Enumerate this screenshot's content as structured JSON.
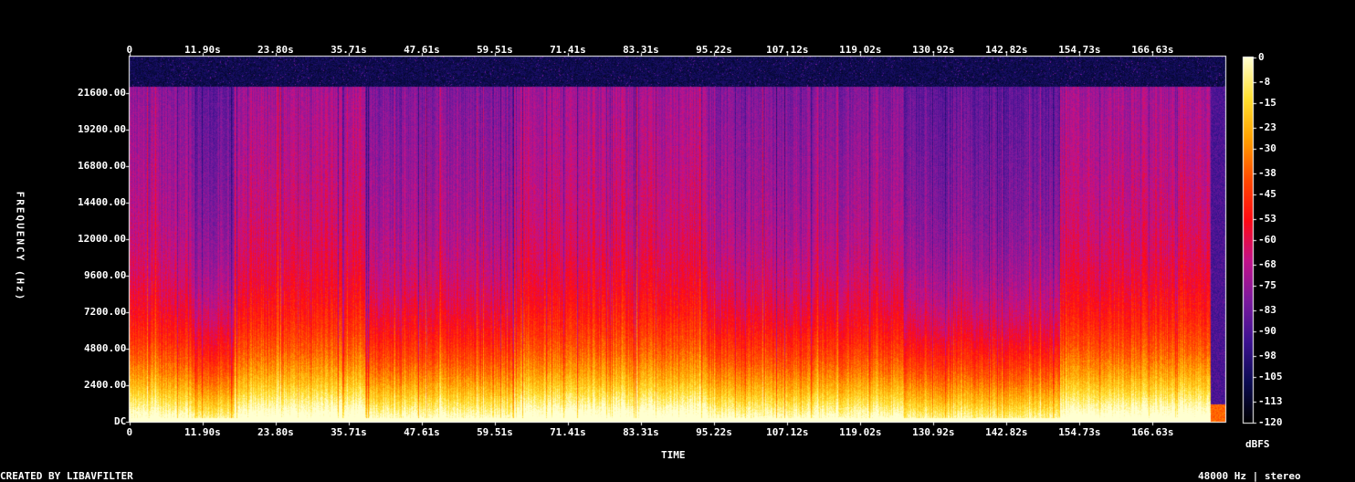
{
  "chart_data": {
    "type": "heatmap",
    "title": "",
    "xlabel": "TIME",
    "ylabel": "FREQUENCY (Hz)",
    "x_ticks": [
      "0",
      "11.90s",
      "23.80s",
      "35.71s",
      "47.61s",
      "59.51s",
      "71.41s",
      "83.31s",
      "95.22s",
      "107.12s",
      "119.02s",
      "130.92s",
      "142.82s",
      "154.73s",
      "166.63s"
    ],
    "x_tick_values": [
      0,
      11.9,
      23.8,
      35.71,
      47.61,
      59.51,
      71.41,
      83.31,
      95.22,
      107.12,
      119.02,
      130.92,
      142.82,
      154.73,
      166.63
    ],
    "xlim": [
      0,
      178.5
    ],
    "y_ticks": [
      "DC",
      "2400.00",
      "4800.00",
      "7200.00",
      "9600.00",
      "12000.00",
      "14400.00",
      "16800.00",
      "19200.00",
      "21600.00"
    ],
    "y_tick_values": [
      0,
      2400,
      4800,
      7200,
      9600,
      12000,
      14400,
      16800,
      19200,
      21600
    ],
    "ylim": [
      0,
      24000
    ],
    "content_cutoff_hz": 22050,
    "colorbar": {
      "label": "dBFS",
      "ticks": [
        "0",
        "-8",
        "-15",
        "-23",
        "-30",
        "-38",
        "-45",
        "-53",
        "-60",
        "-68",
        "-75",
        "-83",
        "-90",
        "-98",
        "-105",
        "-113",
        "-120"
      ],
      "range": [
        -120,
        0
      ],
      "colormap": [
        "#000000",
        "#0c0c52",
        "#3c1290",
        "#7a1a9e",
        "#c2128a",
        "#ff0a14",
        "#ff4a00",
        "#ffa000",
        "#ffe030",
        "#ffffd0"
      ]
    },
    "sections_seconds": [
      {
        "start": 0,
        "end": 10,
        "level": "busy-bands"
      },
      {
        "start": 10,
        "end": 17,
        "level": "quiet"
      },
      {
        "start": 17,
        "end": 38.5,
        "level": "loud"
      },
      {
        "start": 38.5,
        "end": 62.5,
        "level": "medium"
      },
      {
        "start": 62.5,
        "end": 94,
        "level": "loud"
      },
      {
        "start": 94,
        "end": 126,
        "level": "medium"
      },
      {
        "start": 126,
        "end": 151.5,
        "level": "quiet"
      },
      {
        "start": 151.5,
        "end": 176,
        "level": "loud"
      },
      {
        "start": 176,
        "end": 178.5,
        "level": "fade"
      }
    ]
  },
  "footer": {
    "left": "CREATED BY LIBAVFILTER",
    "right": "48000 Hz | stereo"
  }
}
